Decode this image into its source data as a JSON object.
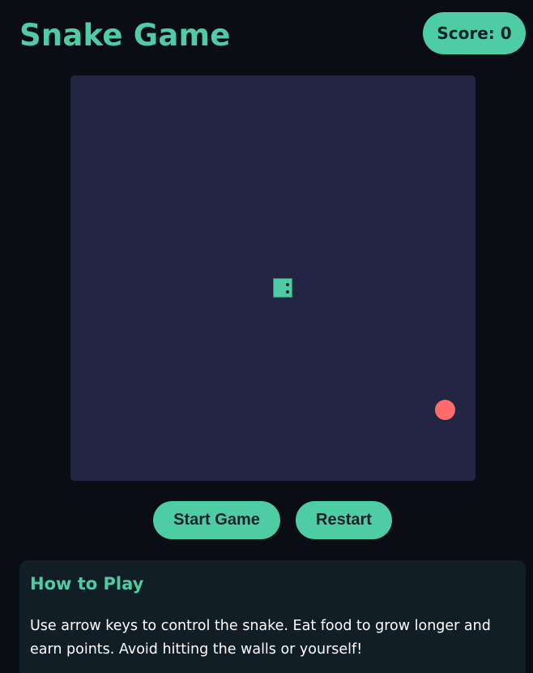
{
  "header": {
    "title": "Snake Game",
    "score_label": "Score:",
    "score_value": "0"
  },
  "game": {
    "snake_length": 1,
    "colors": {
      "snake": "#4ecca3",
      "food": "#ff6b6b",
      "board": "#232642"
    }
  },
  "controls": {
    "start_label": "Start Game",
    "restart_label": "Restart"
  },
  "instructions": {
    "title": "How to Play",
    "text": "Use arrow keys to control the snake. Eat food to grow longer and earn points. Avoid hitting the walls or yourself!"
  },
  "theme": {
    "accent": "#4ecca3",
    "background": "#0b0d15",
    "panel": "#121e26"
  }
}
